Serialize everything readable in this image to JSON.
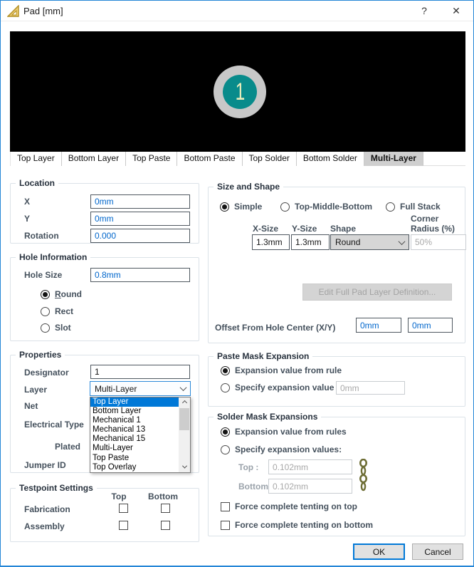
{
  "window": {
    "title": "Pad [mm]",
    "help": "?",
    "close": "✕"
  },
  "preview": {
    "pad_label": "1"
  },
  "tabs": {
    "items": [
      {
        "label": "Top Layer",
        "selected": false
      },
      {
        "label": "Bottom Layer",
        "selected": false
      },
      {
        "label": "Top Paste",
        "selected": false
      },
      {
        "label": "Bottom Paste",
        "selected": false
      },
      {
        "label": "Top Solder",
        "selected": false
      },
      {
        "label": "Bottom Solder",
        "selected": false
      },
      {
        "label": "Multi-Layer",
        "selected": true
      }
    ]
  },
  "location": {
    "title": "Location",
    "rows": [
      {
        "label": "X",
        "value": "0mm"
      },
      {
        "label": "Y",
        "value": "0mm"
      },
      {
        "label": "Rotation",
        "value": "0.000"
      }
    ]
  },
  "hole": {
    "title": "Hole Information",
    "size_label": "Hole Size",
    "size_value": "0.8mm",
    "radio_round": "Round",
    "radio_rect": "Rect",
    "radio_slot": "Slot",
    "selected": "Round"
  },
  "props": {
    "title": "Properties",
    "designator_label": "Designator",
    "designator_value": "1",
    "layer_label": "Layer",
    "layer_value": "Multi-Layer",
    "net_label": "Net",
    "electrical_type_label": "Electrical Type",
    "plated_label": "Plated",
    "jumper_id_label": "Jumper ID",
    "layer_options": [
      "Top Layer",
      "Bottom Layer",
      "Mechanical 1",
      "Mechanical 13",
      "Mechanical 15",
      "Multi-Layer",
      "Top Paste",
      "Top Overlay"
    ],
    "highlighted_option": "Top Layer"
  },
  "testpoint": {
    "title": "Testpoint Settings",
    "col_top": "Top",
    "col_bottom": "Bottom",
    "row_fabrication": "Fabrication",
    "row_assembly": "Assembly"
  },
  "size_shape": {
    "title": "Size and Shape",
    "radio_simple": "Simple",
    "radio_tmb": "Top-Middle-Bottom",
    "radio_full": "Full Stack",
    "selected": "Simple",
    "col_xsize": "X-Size",
    "col_ysize": "Y-Size",
    "col_shape": "Shape",
    "col_corner": "Corner Radius (%)",
    "xsize": "1.3mm",
    "ysize": "1.3mm",
    "shape": "Round",
    "corner": "50%",
    "edit_button": "Edit Full Pad Layer Definition...",
    "offset_label": "Offset From Hole Center (X/Y)",
    "offset_x": "0mm",
    "offset_y": "0mm"
  },
  "paste": {
    "title": "Paste Mask Expansion",
    "radio_rule": "Expansion value from rule",
    "radio_specify": "Specify expansion value",
    "selected": "Expansion value from rule",
    "value": "0mm"
  },
  "solder": {
    "title": "Solder Mask Expansions",
    "radio_rules": "Expansion value from rules",
    "radio_specify": "Specify expansion values:",
    "selected": "Expansion value from rules",
    "top_label": "Top :",
    "top_value": "0.102mm",
    "bottom_label": "Bottom :",
    "bottom_value": "0.102mm",
    "tent_top": "Force complete tenting on top",
    "tent_bottom": "Force complete tenting on bottom"
  },
  "footer": {
    "ok": "OK",
    "cancel": "Cancel"
  },
  "colors": {
    "accent": "#0078d7",
    "value_text": "#0066cc",
    "pad_ring": "#c8c8c8",
    "pad_hole": "#088b8b",
    "pad_number": "#eaedbb",
    "selected_tab_bg": "#cfcfcf"
  }
}
